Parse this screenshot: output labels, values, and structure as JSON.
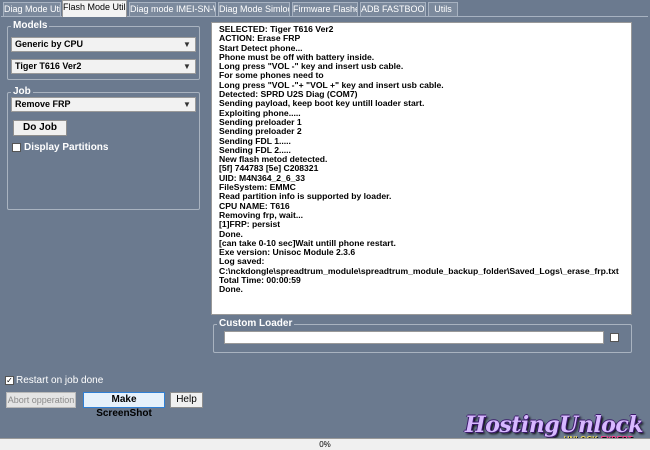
{
  "tabs": [
    {
      "label": "Diag Mode Utils"
    },
    {
      "label": "Flash Mode Utils"
    },
    {
      "label": "Diag mode IMEI-SN-WIFI"
    },
    {
      "label": "Diag Mode Simlock"
    },
    {
      "label": "Firmware Flasher"
    },
    {
      "label": "ADB FASTBOOT"
    },
    {
      "label": "Utils"
    }
  ],
  "models": {
    "title": "Models",
    "cpu_selected": "Generic by CPU",
    "model_selected": "Tiger T616 Ver2"
  },
  "job": {
    "title": "Job",
    "selected": "Remove FRP",
    "do_job_label": "Do Job",
    "display_partitions_label": "Display Partitions",
    "display_partitions_checked": false
  },
  "log": {
    "lines": [
      "SELECTED: Tiger T616 Ver2",
      "ACTION: Erase FRP",
      "Start Detect phone...",
      "Phone must be off with battery inside.",
      "Long press \"VOL -\" key and insert usb cable.",
      "For some phones need to",
      "Long press \"VOL -\"+ \"VOL +\" key and insert usb cable.",
      "Detected: SPRD U2S Diag (COM7)",
      "Sending payload, keep boot key untill loader start.",
      "Exploiting phone.....",
      "Sending preloader 1",
      "Sending preloader 2",
      "Sending FDL 1.....",
      "Sending FDL 2.....",
      "New flash metod detected.",
      "[5f] 744783 [5e] C208321",
      "UID: M4N364_2_6_33",
      "FileSystem: EMMC",
      "Read partition info is supported by loader.",
      "CPU NAME: T616",
      "Removing frp, wait...",
      "[1]FRP: persist",
      "Done.",
      "[can take 0-10 sec]Wait untill phone restart.",
      "Exe version: Unisoc Module 2.3.6",
      "Log saved:",
      "C:\\nckdongle\\spreadtrum_module\\spreadtrum_module_backup_folder\\Saved_Logs\\_erase_frp.txt",
      "Total Time: 00:00:59",
      "Done."
    ]
  },
  "custom_loader": {
    "title": "Custom Loader",
    "value": "",
    "checked": false
  },
  "bottom": {
    "restart_label": "Restart on job done",
    "restart_checked": true,
    "abort_label": "Abort opperation",
    "screenshot_label": "Make ScreenShot",
    "help_label": "Help"
  },
  "progress": {
    "text": "0%",
    "value": 0
  },
  "watermark": {
    "main": "HostingUnlock",
    "sub_a": "UNLOCK",
    "sub_b": "EXPERT"
  }
}
